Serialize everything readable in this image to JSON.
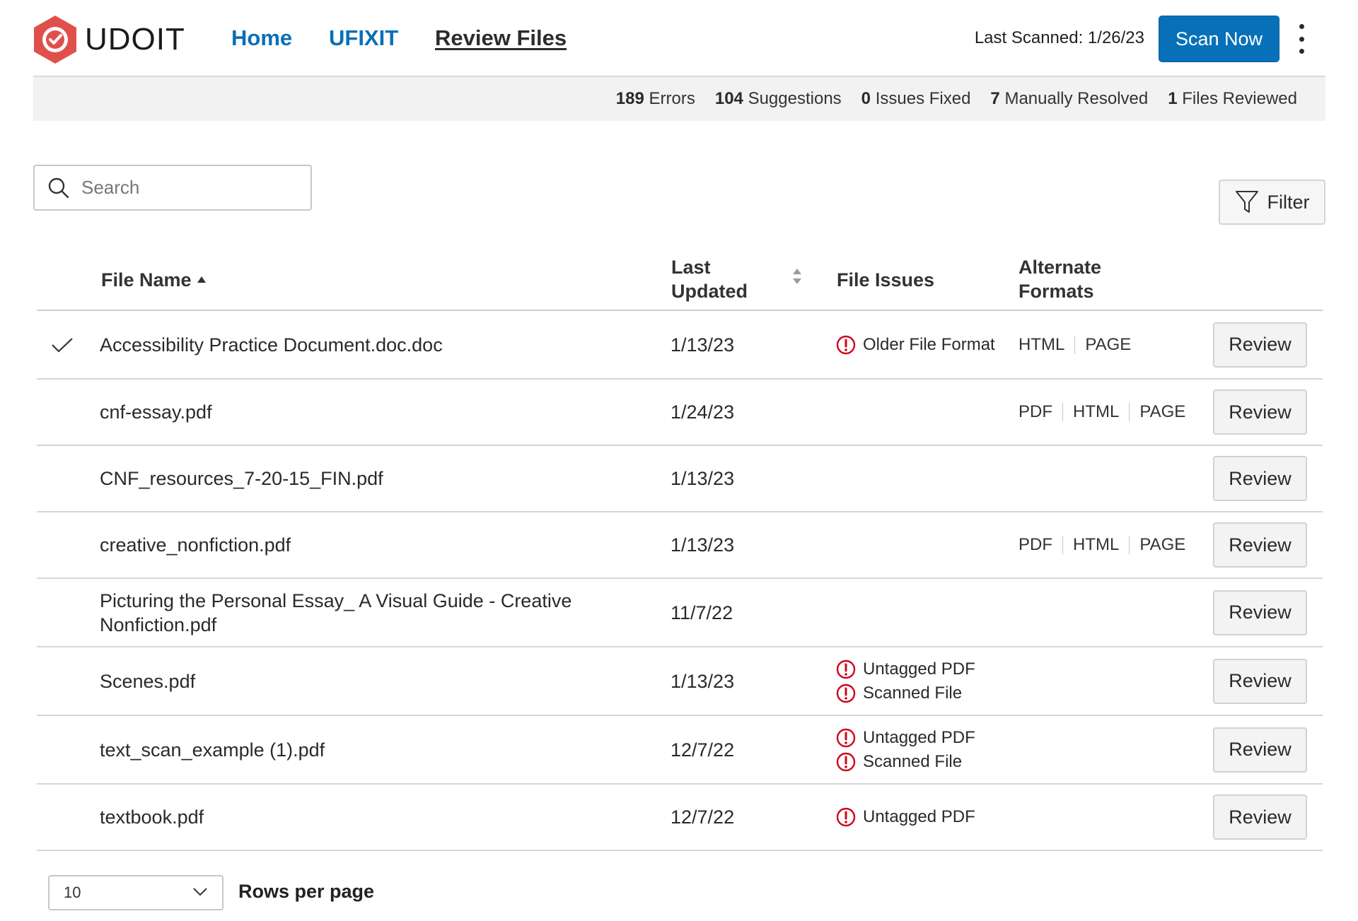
{
  "app": {
    "name": "UDOIT",
    "logo_color": "#e0504b"
  },
  "nav": {
    "home": "Home",
    "ufixit": "UFIXIT",
    "review_files": "Review Files",
    "active": "review_files",
    "link_color": "#0a6fb7"
  },
  "header": {
    "last_scanned": "Last Scanned: 1/26/23",
    "scan_now": "Scan Now",
    "accent": "#0770b8"
  },
  "summary": {
    "errors_count": "189",
    "errors_label": "Errors",
    "suggestions_count": "104",
    "suggestions_label": "Suggestions",
    "fixed_count": "0",
    "fixed_label": "Issues Fixed",
    "manual_count": "7",
    "manual_label": "Manually Resolved",
    "reviewed_count": "1",
    "reviewed_label": "Files Reviewed"
  },
  "search": {
    "placeholder": "Search",
    "value": ""
  },
  "filter": {
    "label": "Filter"
  },
  "table": {
    "columns": {
      "file_name": "File Name",
      "last_updated_1": "Last",
      "last_updated_2": "Updated",
      "file_issues": "File Issues",
      "alt_formats_1": "Alternate",
      "alt_formats_2": "Formats"
    },
    "review_label": "Review",
    "issue_color": "#d0021b",
    "rows": [
      {
        "name": "Accessibility Practice Document.doc.doc",
        "date": "1/13/23",
        "reviewed": true,
        "issues": [
          "Older File Format"
        ],
        "formats": [
          "HTML",
          "PAGE"
        ]
      },
      {
        "name": "cnf-essay.pdf",
        "date": "1/24/23",
        "reviewed": false,
        "issues": [],
        "formats": [
          "PDF",
          "HTML",
          "PAGE"
        ]
      },
      {
        "name": "CNF_resources_7-20-15_FIN.pdf",
        "date": "1/13/23",
        "reviewed": false,
        "issues": [],
        "formats": []
      },
      {
        "name": "creative_nonfiction.pdf",
        "date": "1/13/23",
        "reviewed": false,
        "issues": [],
        "formats": [
          "PDF",
          "HTML",
          "PAGE"
        ]
      },
      {
        "name": "Picturing the Personal Essay_ A Visual Guide - Creative Nonfiction.pdf",
        "date": "11/7/22",
        "reviewed": false,
        "issues": [],
        "formats": []
      },
      {
        "name": "Scenes.pdf",
        "date": "1/13/23",
        "reviewed": false,
        "issues": [
          "Untagged PDF",
          "Scanned File"
        ],
        "formats": []
      },
      {
        "name": "text_scan_example (1).pdf",
        "date": "12/7/22",
        "reviewed": false,
        "issues": [
          "Untagged PDF",
          "Scanned File"
        ],
        "formats": []
      },
      {
        "name": "textbook.pdf",
        "date": "12/7/22",
        "reviewed": false,
        "issues": [
          "Untagged PDF"
        ],
        "formats": []
      }
    ]
  },
  "pagination": {
    "rows_per_page_value": "10",
    "rows_per_page_label": "Rows per page"
  }
}
